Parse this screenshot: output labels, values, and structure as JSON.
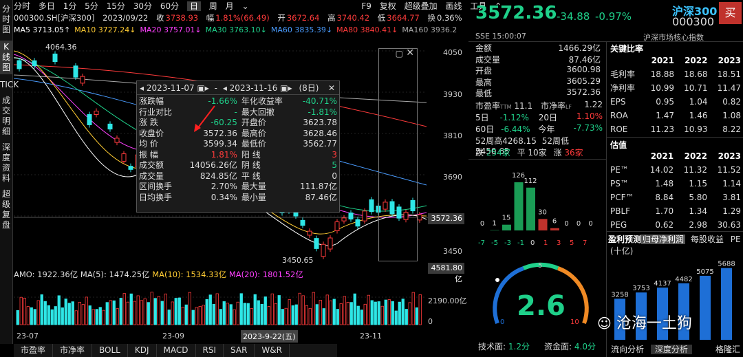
{
  "leftbar": {
    "items": [
      "分时图",
      "K线图",
      "TICK",
      "成交明细",
      "深度资料",
      "超级复盘"
    ]
  },
  "topbar": {
    "tabs": [
      "分时",
      "多日",
      "1分",
      "5分",
      "15分",
      "30分",
      "60分",
      "日",
      "周",
      "月",
      "⌄"
    ],
    "right": [
      "F9",
      "复权",
      "超级叠加",
      "画线",
      "工具",
      "⌃"
    ]
  },
  "info": {
    "code": "000300.SH[沪深300]",
    "date": "2023/09/22",
    "close_label": "收",
    "close": "3738.93",
    "chg_label": "幅",
    "chg": "1.81%(66.49)",
    "open_label": "开",
    "open": "3672.64",
    "high_label": "高",
    "high": "3740.42",
    "low_label": "低",
    "low": "3664.77",
    "turn_label": "换",
    "turn": "0.36%"
  },
  "ma": [
    {
      "label": "MA5",
      "value": "3713.05",
      "arrow": "↑",
      "color": "#ffffff"
    },
    {
      "label": "MA10",
      "value": "3727.24",
      "arrow": "↓",
      "color": "#ffcc33"
    },
    {
      "label": "MA20",
      "value": "3757.01",
      "arrow": "↓",
      "color": "#ff40ff"
    },
    {
      "label": "MA30",
      "value": "3763.10",
      "arrow": "↓",
      "color": "#1fd08a"
    },
    {
      "label": "MA60",
      "value": "3835.39",
      "arrow": "↓",
      "color": "#4a9cff"
    },
    {
      "label": "MA80",
      "value": "3840.41",
      "arrow": "↓",
      "color": "#ff3b3b"
    },
    {
      "label": "MA160",
      "value": "3936.2",
      "arrow": "",
      "color": "#aaaaaa"
    }
  ],
  "chart": {
    "y_ticks": [
      "4050",
      "3930",
      "3810",
      "3690",
      "3450"
    ],
    "current_price": "3572.36",
    "high_marker": "4064.36",
    "low_marker": "3450.65",
    "vol_max": "4581.80亿",
    "vol_mid": "2190.00亿",
    "vol_zero": "0",
    "dates": [
      "23-07",
      "23-09",
      "2023-9-22(五)",
      "23-11"
    ]
  },
  "vol_legend": {
    "amo": "AMO: 1922.36亿",
    "ma5": "MA(5): 1474.25亿",
    "ma10": "MA(10): 1534.33亿",
    "ma20": "MA(20): 1801.52亿"
  },
  "popup": {
    "start": "2023-11-07",
    "end": "2023-11-16",
    "days": "(8日)",
    "rows": [
      [
        "涨跌幅",
        "-1.66%",
        "年化收益率",
        "-40.71%"
      ],
      [
        "行业对比",
        "-",
        "最大回撤",
        "-1.81%"
      ],
      [
        "涨 跌",
        "-60.25",
        "开盘价",
        "3623.78"
      ],
      [
        "收盘价",
        "3572.36",
        "最高价",
        "3628.46"
      ],
      [
        "均 价",
        "3599.34",
        "最低价",
        "3562.77"
      ],
      [
        "振 幅",
        "1.81%",
        "阳 线",
        "3"
      ],
      [
        "成交额",
        "14056.26亿",
        "阴 线",
        "5"
      ],
      [
        "成交量",
        "824.85亿",
        "平 线",
        "0"
      ],
      [
        "区间换手",
        "2.70%",
        "最大量",
        "111.87亿"
      ],
      [
        "日均换手",
        "0.34%",
        "最小量",
        "87.46亿"
      ]
    ]
  },
  "bottomtabs": [
    "市盈率",
    "市净率",
    "BOLL",
    "KDJ",
    "MACD",
    "RSI",
    "SAR",
    "W&R"
  ],
  "quote": {
    "price": "3572.36",
    "change": "-34.88",
    "pct": "-0.97%",
    "name": "沪深300",
    "code": "000300",
    "sell_btn": "买",
    "exch": "SSE",
    "time": "15:00:07",
    "index_label": "沪深市场核心指数",
    "stats": [
      [
        "金额",
        "1466.29亿"
      ],
      [
        "成交量",
        "87.46亿"
      ],
      [
        "开盘",
        "3600.98"
      ],
      [
        "最高",
        "3605.29"
      ],
      [
        "最低",
        "3572.36"
      ]
    ],
    "pe": "11.1",
    "pb": "1.22",
    "d5": "-1.12%",
    "d20": "1.10%",
    "d60": "-6.44%",
    "ytd": "-7.73%",
    "h52": "4268.15",
    "l52": "3450.65",
    "down": "254家",
    "flat": "10家",
    "up": "36家"
  },
  "histogram": {
    "values": [
      0,
      1,
      15,
      126,
      112,
      30,
      6,
      0,
      0,
      0
    ],
    "labels": [
      "-7",
      "-5",
      "-3",
      "-1",
      "0",
      "1",
      "3",
      "5",
      "7",
      "7"
    ]
  },
  "gauge": {
    "value": "2.6",
    "min": "0",
    "mid": "5",
    "max": "10",
    "tech_label": "技术面:",
    "tech": "1.2分",
    "fund_label": "资金面:",
    "fund": "4.0分"
  },
  "indicators": {
    "title": "关键比率",
    "years": [
      "2021",
      "2022",
      "2023"
    ],
    "rows": [
      [
        "毛利率",
        "18.88",
        "18.68",
        "18.51"
      ],
      [
        "净利率",
        "10.99",
        "10.71",
        "11.47"
      ],
      [
        "EPS",
        "0.95",
        "1.04",
        "0.82"
      ],
      [
        "ROA",
        "1.47",
        "1.46",
        "1.08"
      ],
      [
        "ROE",
        "11.23",
        "10.93",
        "8.22"
      ]
    ]
  },
  "valuation": {
    "title": "估值",
    "years": [
      "2021",
      "2022",
      "2023"
    ],
    "rows": [
      [
        "PE™",
        "14.02",
        "11.32",
        "11.52"
      ],
      [
        "PS™",
        "1.48",
        "1.15",
        "1.14"
      ],
      [
        "PCF™",
        "8.84",
        "5.80",
        "3.81"
      ],
      [
        "PBLF",
        "1.70",
        "1.34",
        "1.29"
      ],
      [
        "PEG",
        "0.62",
        "2.98",
        "30.63"
      ]
    ]
  },
  "forecast": {
    "tabs": [
      "盈利预测",
      "归母净利润",
      "每股收益",
      "PE"
    ],
    "unit": "(十亿)",
    "values": [
      3258,
      3753,
      4137,
      4482,
      5075,
      5688
    ]
  },
  "bottomright": {
    "tabs": [
      "流向分析",
      "深度分析"
    ],
    "watermark": "沧海一土狗",
    "brand": "格隆汇"
  }
}
